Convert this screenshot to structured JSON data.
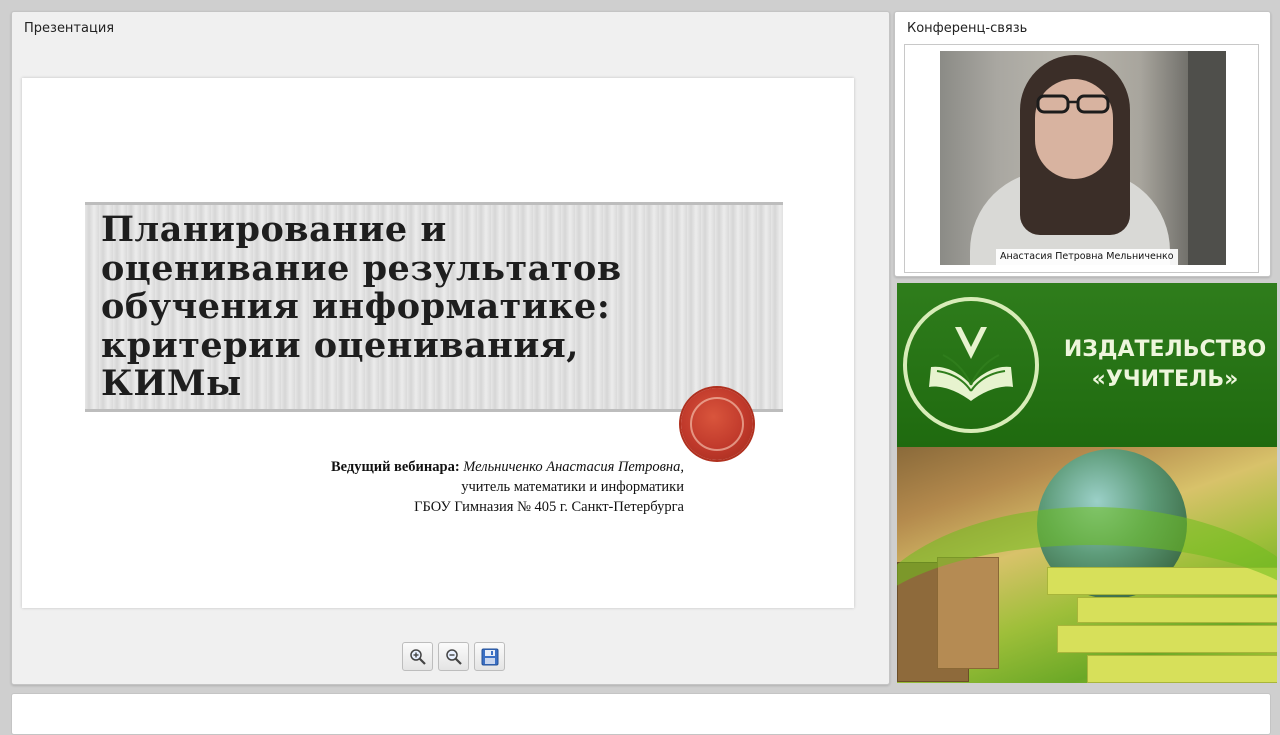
{
  "presentation": {
    "panel_title": "Презентация",
    "slide": {
      "title": "Планирование и\nоценивание результатов\nобучения информатике:\nкритерии оценивания,\nКИМы",
      "presenter_label": "Ведущий вебинара:",
      "presenter_name": "Мельниченко Анастасия Петровна,",
      "presenter_role": "учитель математики и информатики",
      "presenter_school": "ГБОУ Гимназия № 405 г. Санкт-Петербурга"
    },
    "toolbar": {
      "zoom_in_icon": "zoom-in-icon",
      "zoom_out_icon": "zoom-out-icon",
      "save_icon": "floppy-disk-icon"
    }
  },
  "conference": {
    "panel_title": "Конференц-связь",
    "participant_name": "Анастасия Петровна Мельниченко"
  },
  "banner": {
    "publisher_line1": "ИЗДАТЕЛЬСТВО",
    "publisher_line2": "«УЧИТЕЛЬ»",
    "colors": {
      "green": "#2f7d1c",
      "text": "#eef6dc"
    }
  },
  "colors": {
    "background": "#cfcfcf",
    "panel": "#ffffff",
    "seal": "#c0392b"
  }
}
